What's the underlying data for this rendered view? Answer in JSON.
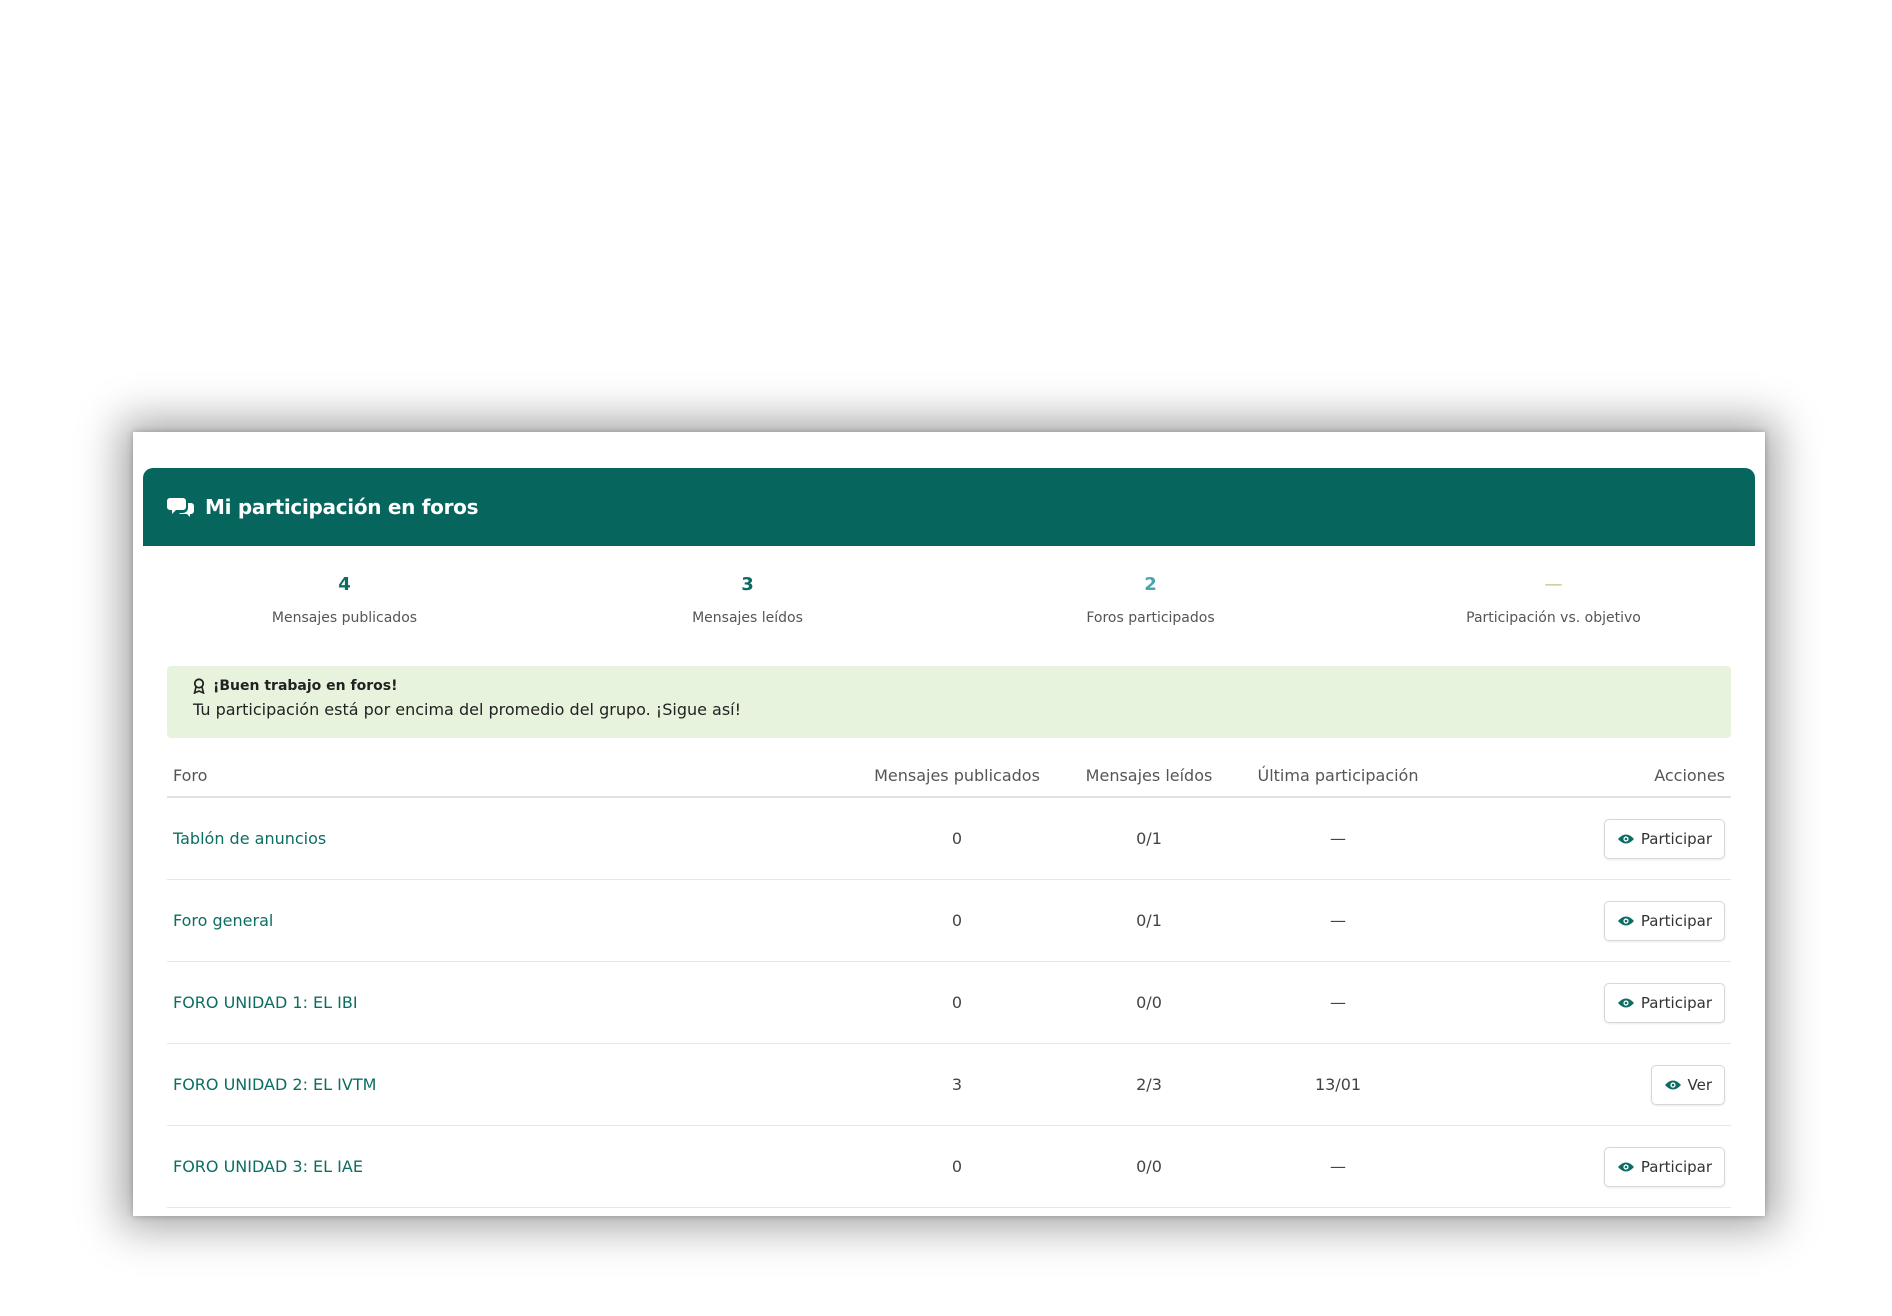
{
  "panel": {
    "title": "Mi participación en foros"
  },
  "colors": {
    "header": "#06655c",
    "accent": "#0c6e62",
    "light_accent": "#4aa3ad",
    "alert_bg": "#e8f3dd"
  },
  "stats": [
    {
      "value": "4",
      "label": "Mensajes publicados",
      "color": "#0c6e62"
    },
    {
      "value": "3",
      "label": "Mensajes leídos",
      "color": "#0c6e62"
    },
    {
      "value": "2",
      "label": "Foros participados",
      "color": "#4aa3ad"
    },
    {
      "value": "—",
      "label": "Participación vs. objetivo",
      "color": "#b5c97a"
    }
  ],
  "alert": {
    "icon": "award-icon",
    "title": "¡Buen trabajo en foros!",
    "message": "Tu participación está por encima del promedio del grupo. ¡Sigue así!"
  },
  "table": {
    "headers": {
      "foro": "Foro",
      "publicados": "Mensajes publicados",
      "leidos": "Mensajes leídos",
      "ultima": "Última participación",
      "acciones": "Acciones"
    },
    "rows": [
      {
        "foro": "Tablón de anuncios",
        "publicados": "0",
        "leidos": "0/1",
        "ultima": "—",
        "action": "Participar"
      },
      {
        "foro": "Foro general",
        "publicados": "0",
        "leidos": "0/1",
        "ultima": "—",
        "action": "Participar"
      },
      {
        "foro": "FORO UNIDAD 1: EL IBI",
        "publicados": "0",
        "leidos": "0/0",
        "ultima": "—",
        "action": "Participar"
      },
      {
        "foro": "FORO UNIDAD 2: EL IVTM",
        "publicados": "3",
        "leidos": "2/3",
        "ultima": "13/01",
        "action": "Ver"
      },
      {
        "foro": "FORO UNIDAD 3: EL IAE",
        "publicados": "0",
        "leidos": "0/0",
        "ultima": "—",
        "action": "Participar"
      }
    ]
  }
}
